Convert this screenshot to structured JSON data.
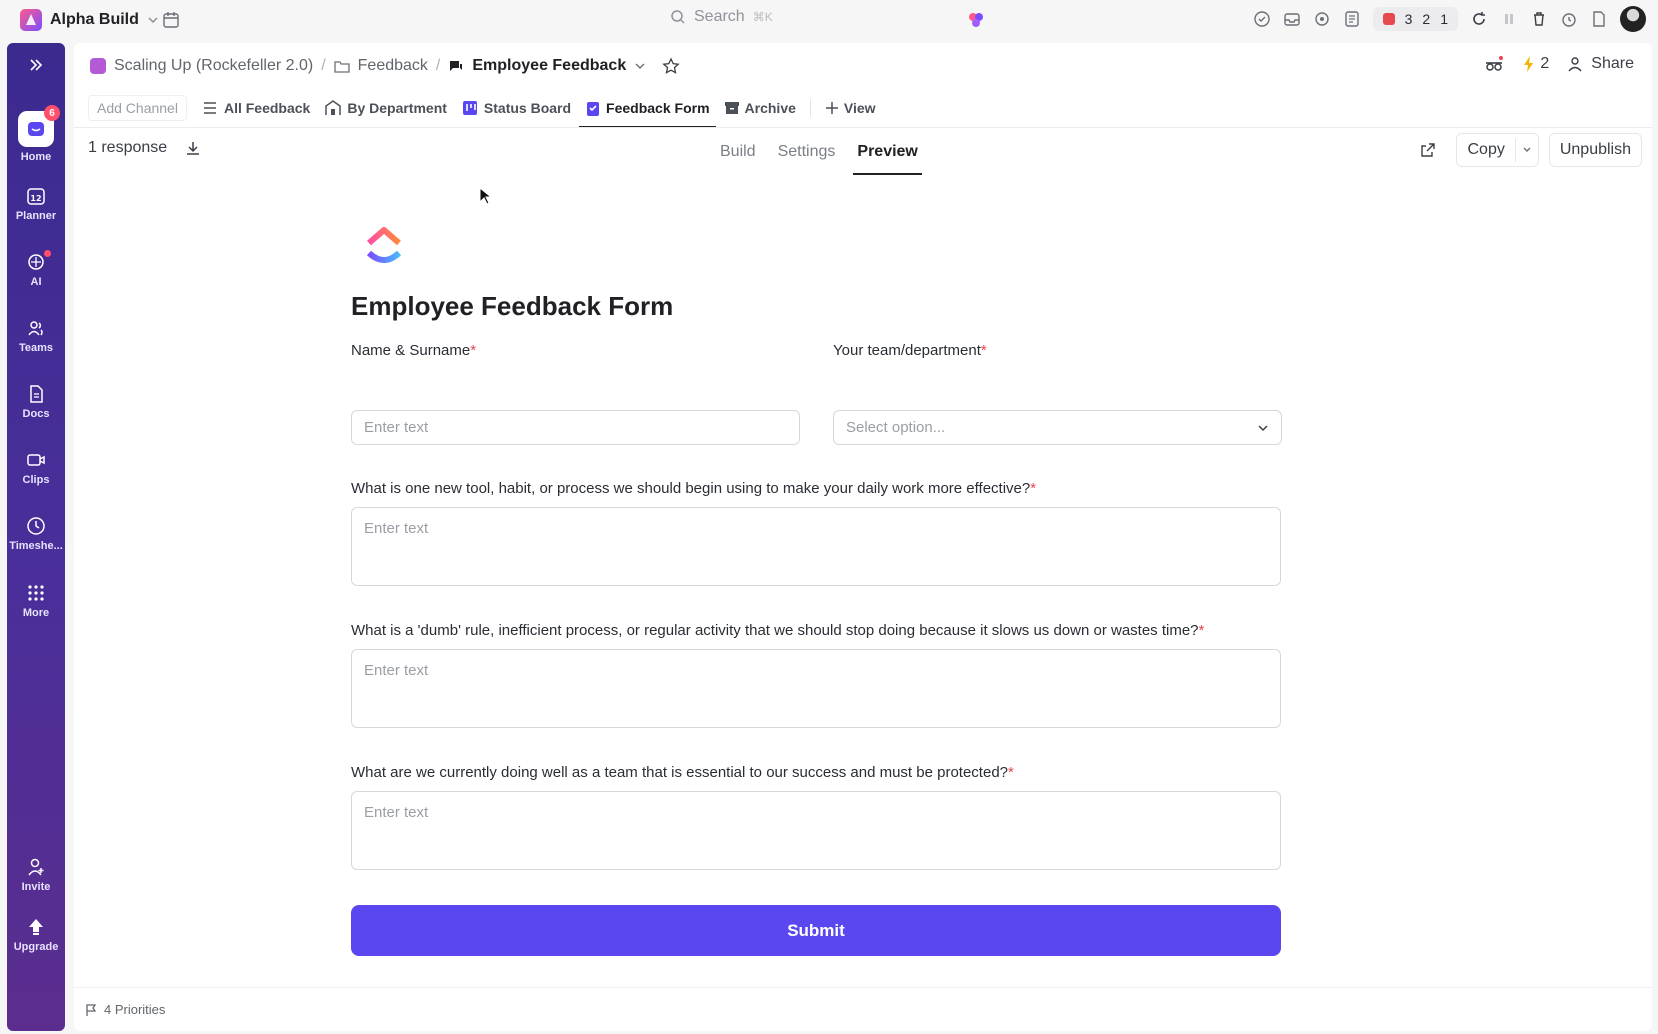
{
  "topbar": {
    "workspace": "Alpha Build",
    "search_placeholder": "Search",
    "search_shortcut": "⌘K",
    "counts": [
      "3",
      "2",
      "1"
    ]
  },
  "sidebar": {
    "items": [
      {
        "label": "Home",
        "badge": "6"
      },
      {
        "label": "Planner",
        "date": "12"
      },
      {
        "label": "AI"
      },
      {
        "label": "Teams"
      },
      {
        "label": "Docs"
      },
      {
        "label": "Clips"
      },
      {
        "label": "Timeshe..."
      },
      {
        "label": "More"
      },
      {
        "label": "Invite"
      },
      {
        "label": "Upgrade"
      }
    ]
  },
  "header": {
    "space": "Scaling Up (Rockefeller 2.0)",
    "folder": "Feedback",
    "list": "Employee Feedback",
    "automations_count": "2",
    "share": "Share"
  },
  "views": {
    "add_channel": "Add Channel",
    "tabs": [
      "All Feedback",
      "By Department",
      "Status Board",
      "Feedback Form",
      "Archive"
    ],
    "add_view": "View"
  },
  "subbar": {
    "responses": "1 response",
    "tabs": [
      "Build",
      "Settings",
      "Preview"
    ],
    "copy": "Copy",
    "unpublish": "Unpublish"
  },
  "form": {
    "title": "Employee Feedback Form",
    "fields": [
      {
        "label": "Name & Surname",
        "placeholder": "Enter text"
      },
      {
        "label": "Your team/department",
        "placeholder": "Select option..."
      },
      {
        "label": "What is one new tool, habit, or process we should begin using to make your daily work more effective?",
        "placeholder": "Enter text"
      },
      {
        "label": "What is a 'dumb' rule, inefficient process, or regular activity that we should stop doing because it slows us down or wastes time?",
        "placeholder": "Enter text"
      },
      {
        "label": "What are we currently doing well as a team that is essential to our success and must be protected?",
        "placeholder": "Enter text"
      }
    ],
    "required_mark": "*",
    "submit": "Submit"
  },
  "footer": {
    "priorities": "4 Priorities"
  },
  "colors": {
    "accent": "#5b47f0",
    "sidebar": "#43308f",
    "required": "#e5484d"
  }
}
